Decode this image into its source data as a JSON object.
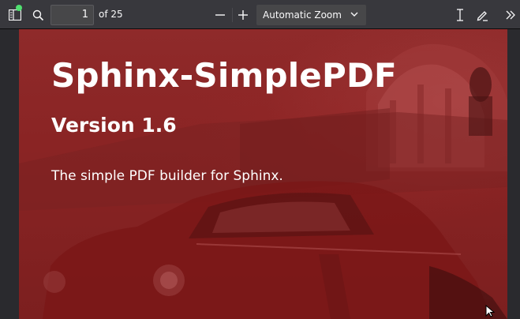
{
  "toolbar": {
    "page_number": "1",
    "page_count": "of 25",
    "zoom": "Automatic Zoom",
    "icons": [
      "sidebar-toggle-icon",
      "search-icon",
      "zoom-out-icon",
      "zoom-in-icon",
      "chevron-down-icon",
      "text-cursor-icon",
      "pen-edit-icon",
      "double-chevron-right-icon"
    ],
    "status_dot_color": "#50e070"
  },
  "document": {
    "title": "Sphinx-SimplePDF",
    "version": "Version 1.6",
    "tagline": "The simple PDF builder for Sphinx."
  }
}
